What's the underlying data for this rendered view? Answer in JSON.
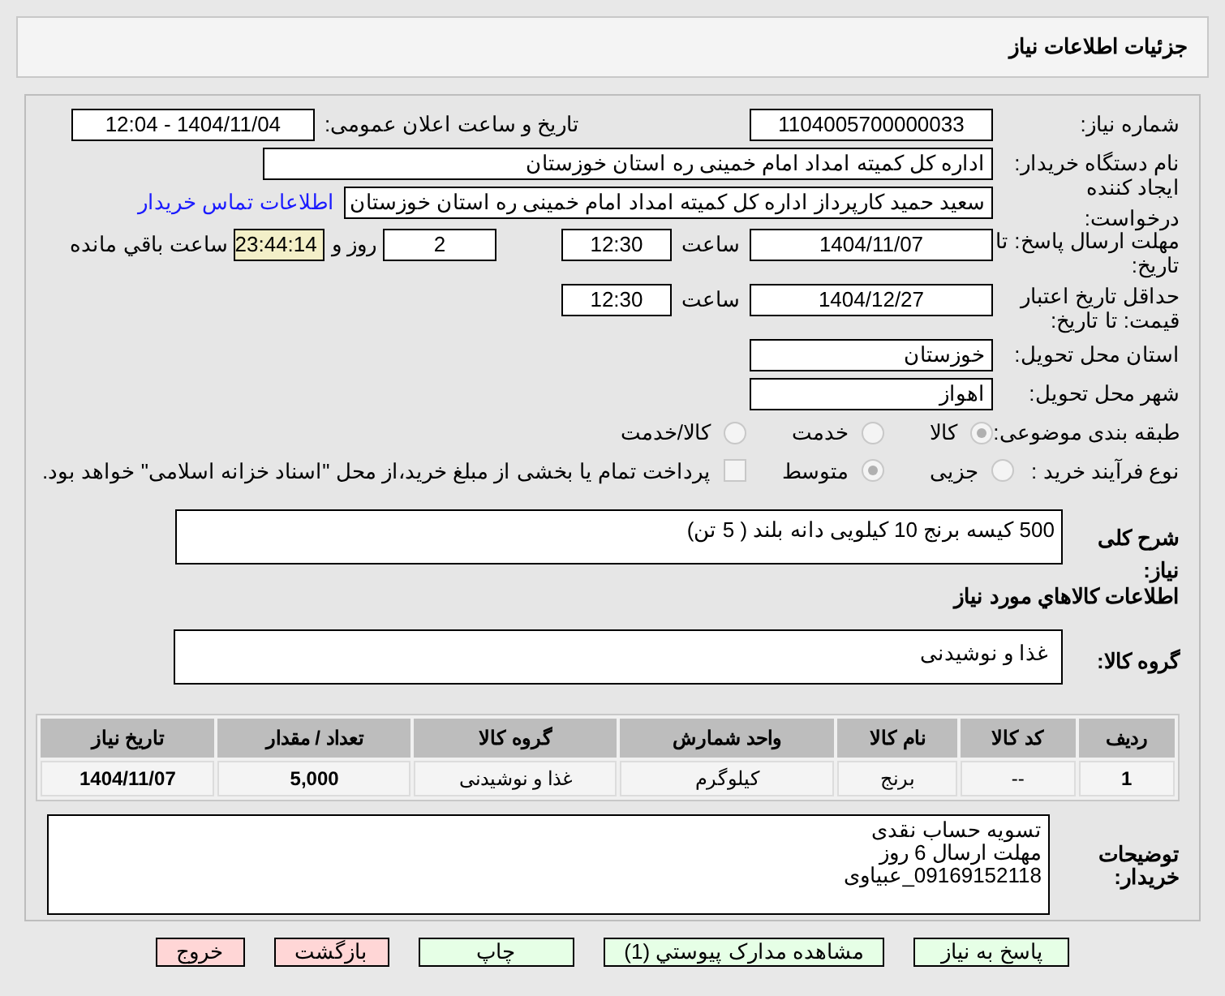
{
  "title": "جزئیات اطلاعات نیاز",
  "need_number": {
    "label": "شماره نیاز:",
    "value": "1104005700000033"
  },
  "announce": {
    "label": "تاریخ و ساعت اعلان عمومی:",
    "value": "1404/11/04 - 12:04"
  },
  "buyer_org": {
    "label": "نام دستگاه خریدار:",
    "value": "اداره کل کمیته امداد امام خمینی  ره  استان خوزستان"
  },
  "requester": {
    "label": "ایجاد کننده درخواست:",
    "value": "سعید حمید کارپرداز اداره کل کمیته امداد امام خمینی  ره  استان خوزستان",
    "link": "اطلاعات تماس خریدار"
  },
  "deadline": {
    "label": "مهلت ارسال پاسخ: تا تاریخ:",
    "date": "1404/11/07",
    "time_label": "ساعت",
    "time": "12:30",
    "days": "2",
    "days_label": "روز و",
    "remaining": "23:44:14",
    "remaining_label": "ساعت باقي مانده"
  },
  "validity": {
    "label": "حداقل تاریخ اعتبار قیمت: تا تاریخ:",
    "date": "1404/12/27",
    "time_label": "ساعت",
    "time": "12:30"
  },
  "province": {
    "label": "استان محل تحویل:",
    "value": "خوزستان"
  },
  "city": {
    "label": "شهر محل تحویل:",
    "value": "اهواز"
  },
  "category": {
    "label": "طبقه بندی موضوعی:",
    "options": [
      {
        "label": "کالا",
        "selected": true
      },
      {
        "label": "خدمت",
        "selected": false
      },
      {
        "label": "کالا/خدمت",
        "selected": false
      }
    ]
  },
  "purchase_type": {
    "label": "نوع فرآیند خرید :",
    "options": [
      {
        "label": "جزیی",
        "selected": false
      },
      {
        "label": "متوسط",
        "selected": true
      }
    ],
    "payment": {
      "label": "پرداخت تمام یا بخشی از مبلغ خرید،از محل \"اسناد خزانه اسلامی\" خواهد بود.",
      "checked": false
    }
  },
  "description": {
    "label": "شرح کلی نیاز:",
    "value": "500 کیسه برنج 10 کیلویی دانه بلند ( 5 تن)"
  },
  "goods_heading": "اطلاعات کالاهاي مورد نیاز",
  "goods_group": {
    "label": "گروه کالا:",
    "value": "غذا و نوشیدنی"
  },
  "table": {
    "columns": [
      "ردیف",
      "کد کالا",
      "نام کالا",
      "واحد شمارش",
      "گروه کالا",
      "تعداد / مقدار",
      "تاریخ نیاز"
    ],
    "rows": [
      [
        "1",
        "--",
        "برنج",
        "کیلوگرم",
        "غذا و نوشیدنی",
        "5,000",
        "1404/11/07"
      ]
    ]
  },
  "buyer_notes": {
    "label": "توضیحات خریدار:",
    "lines": [
      "تسویه حساب نقدی",
      "مهلت ارسال 6 روز",
      "09169152118_عبیاوی"
    ]
  },
  "buttons": [
    {
      "label": "پاسخ به نیاز",
      "kind": "action"
    },
    {
      "label": "مشاهده مدارک پیوستي (1)",
      "kind": "action"
    },
    {
      "label": "چاپ",
      "kind": "action"
    },
    {
      "label": "بازگشت",
      "kind": "exit"
    },
    {
      "label": "خروج",
      "kind": "exit"
    }
  ]
}
